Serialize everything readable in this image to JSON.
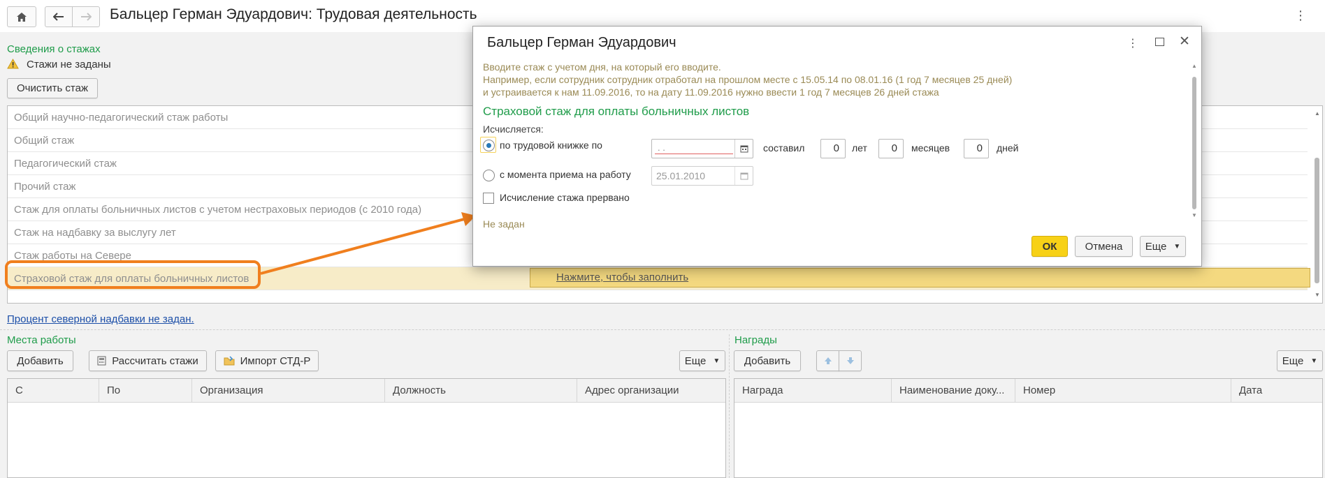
{
  "window": {
    "title": "Бальцер Герман Эдуардович: Трудовая деятельность",
    "menu_icon": "kebab-icon"
  },
  "stazh_section": {
    "heading": "Сведения о стажах",
    "warning_text": "Стажи не заданы",
    "clear_button": "Очистить стаж",
    "rows": [
      "Общий научно-педагогический стаж работы",
      "Общий стаж",
      "Педагогический стаж",
      "Прочий стаж",
      "Стаж для оплаты больничных листов с учетом нестраховых периодов (с 2010 года)",
      "Стаж на надбавку за выслугу лет",
      "Стаж работы на Севере",
      "Страховой стаж для оплаты больничных листов"
    ],
    "fill_link": "Нажмите, чтобы заполнить",
    "north_link": "Процент северной надбавки не задан."
  },
  "work_places": {
    "heading": "Места работы",
    "add_button": "Добавить",
    "calc_button": "Рассчитать стажи",
    "import_button": "Импорт СТД-Р",
    "more_button": "Еще",
    "columns": [
      "С",
      "По",
      "Организация",
      "Должность",
      "Адрес организации"
    ]
  },
  "awards": {
    "heading": "Награды",
    "add_button": "Добавить",
    "more_button": "Еще",
    "columns": [
      "Награда",
      "Наименование доку...",
      "Номер",
      "Дата"
    ]
  },
  "dialog": {
    "title": "Бальцер Герман Эдуардович",
    "hint_line1": "Вводите стаж с учетом дня, на который его вводите.",
    "hint_line2": "Например, если сотрудник сотрудник отработал на прошлом месте с 15.05.14 по 08.01.16 (1 год 7 месяцев 25 дней)",
    "hint_line3": "и устраивается к нам 11.09.2016, то на дату 11.09.2016 нужно ввести 1 год 7 месяцев 26 дней стажа",
    "section_title": "Страховой стаж для оплаты больничных листов",
    "calc_label": "Исчисляется:",
    "option_book": "по трудовой книжке по",
    "book_date_value": " .  .",
    "composed_label": "составил",
    "years_value": "0",
    "years_label": "лет",
    "months_value": "0",
    "months_label": "месяцев",
    "days_value": "0",
    "days_label": "дней",
    "option_hire": "с момента приема на работу",
    "hire_date_value": "25.01.2010",
    "interrupted_label": "Исчисление стажа прервано",
    "status_text": "Не задан",
    "ok_button": "ОК",
    "cancel_button": "Отмена",
    "more_button": "Еще"
  },
  "colors": {
    "accent_green": "#1f9c4a",
    "highlight_orange": "#f07f1e",
    "ok_yellow": "#f7d117",
    "selected_row": "#f4d980"
  }
}
